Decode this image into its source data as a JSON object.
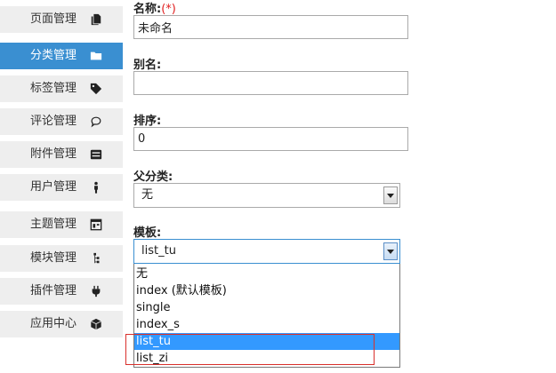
{
  "sidebar": {
    "items": [
      {
        "label": "页面管理",
        "icon": "file-copy-icon",
        "active": false
      },
      {
        "label": "分类管理",
        "icon": "folder-icon",
        "active": true
      },
      {
        "label": "标签管理",
        "icon": "tag-icon",
        "active": false
      },
      {
        "label": "评论管理",
        "icon": "comment-icon",
        "active": false
      },
      {
        "label": "附件管理",
        "icon": "archive-icon",
        "active": false
      },
      {
        "label": "用户管理",
        "icon": "person-icon",
        "active": false
      },
      {
        "label": "主题管理",
        "icon": "layout-icon",
        "active": false
      },
      {
        "label": "模块管理",
        "icon": "sitemap-icon",
        "active": false
      },
      {
        "label": "插件管理",
        "icon": "plug-icon",
        "active": false
      },
      {
        "label": "应用中心",
        "icon": "cube-icon",
        "active": false
      }
    ]
  },
  "form": {
    "name": {
      "label": "名称:",
      "required_mark": "(*)",
      "value": "未命名"
    },
    "alias": {
      "label": "别名:",
      "value": ""
    },
    "order": {
      "label": "排序:",
      "value": "0"
    },
    "parent": {
      "label": "父分类:",
      "value": "无"
    },
    "template": {
      "label": "模板:",
      "value": "list_tu",
      "options": [
        "无",
        "index (默认模板)",
        "single",
        "index_s",
        "list_tu",
        "list_zi"
      ],
      "selected_option": "list_tu"
    }
  },
  "colors": {
    "sidebar_active": "#3a8fd1",
    "sidebar_bg": "#eeeeee",
    "option_selected": "#3399ff",
    "highlight_border": "#d9302c",
    "required": "#e02020"
  }
}
